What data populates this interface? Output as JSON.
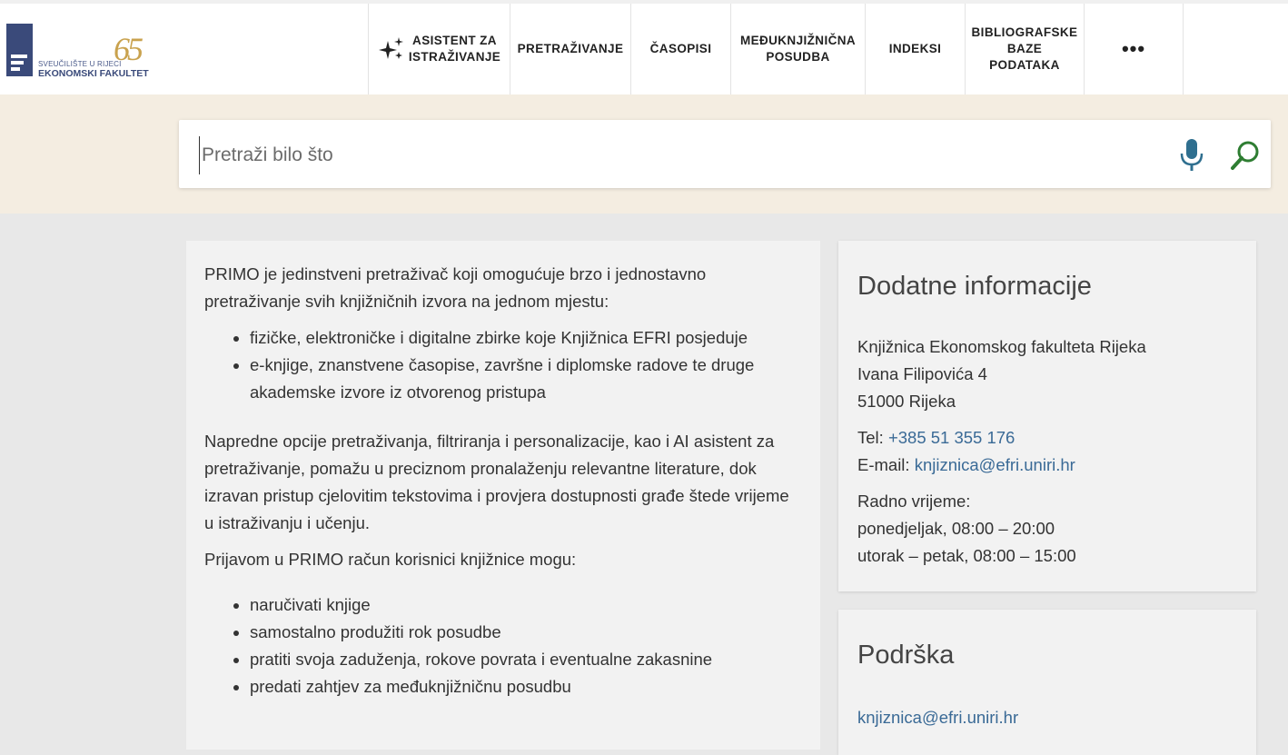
{
  "logo": {
    "anniversary": "65",
    "university": "SVEUČILIŠTE U RIJECI",
    "faculty": "EKONOMSKI FAKULTET"
  },
  "nav": {
    "items": [
      {
        "label": "ASISTENT ZA\nISTRAŽIVANJE",
        "icon": "sparkle-icon"
      },
      {
        "label": "PRETRAŽIVANJE"
      },
      {
        "label": "ČASOPISI"
      },
      {
        "label": "MEĐUKNJIŽNIČNA\nPOSUDBA"
      },
      {
        "label": "INDEKSI"
      },
      {
        "label": "BIBLIOGRAFSKE\nBAZE\nPODATAKA"
      },
      {
        "label": "•••",
        "icon": "more-icon"
      }
    ]
  },
  "search": {
    "placeholder": "Pretraži bilo što",
    "value": ""
  },
  "main": {
    "intro": "PRIMO je jedinstveni pretraživač koji omogućuje brzo i jednostavno pretraživanje svih knjižničnih izvora na jednom mjestu:",
    "sources": [
      "fizičke, elektroničke i digitalne zbirke koje Knjižnica EFRI posjeduje",
      "e-knjige, znanstvene časopise, završne i diplomske radove te druge akademske izvore iz otvorenog pristupa"
    ],
    "advanced": "Napredne opcije pretraživanja, filtriranja i personalizacije, kao i AI asistent za pretraživanje, pomažu u preciznom pronalaženju relevantne literature, dok izravan pristup cjelovitim tekstovima i provjera dostupnosti građe štede vrijeme u istraživanju i učenju.",
    "login_intro": "Prijavom u PRIMO račun korisnici knjižnice mogu:",
    "login_benefits": [
      "naručivati knjige",
      "samostalno produžiti rok posudbe",
      "pratiti svoja zaduženja, rokove povrata i eventualne zakasnine",
      "predati zahtjev za međuknjižničnu posudbu"
    ]
  },
  "info": {
    "title": "Dodatne informacije",
    "address": [
      "Knjižnica Ekonomskog fakulteta Rijeka",
      "Ivana Filipovića 4",
      "51000 Rijeka"
    ],
    "tel_label": "Tel: ",
    "tel": "+385 51 355 176",
    "email_label": "E-mail: ",
    "email": "knjiznica@efri.uniri.hr",
    "hours_title": "Radno vrijeme:",
    "hours": [
      "ponedjeljak, 08:00 – 20:00",
      "utorak – petak, 08:00 – 15:00"
    ]
  },
  "support": {
    "title": "Podrška",
    "email": "knjiznica@efri.uniri.hr"
  },
  "colors": {
    "accent_green": "#2e7d32",
    "mic_blue": "#2f6f8f",
    "link": "#3a6a96",
    "search_band": "#f4ede1"
  }
}
